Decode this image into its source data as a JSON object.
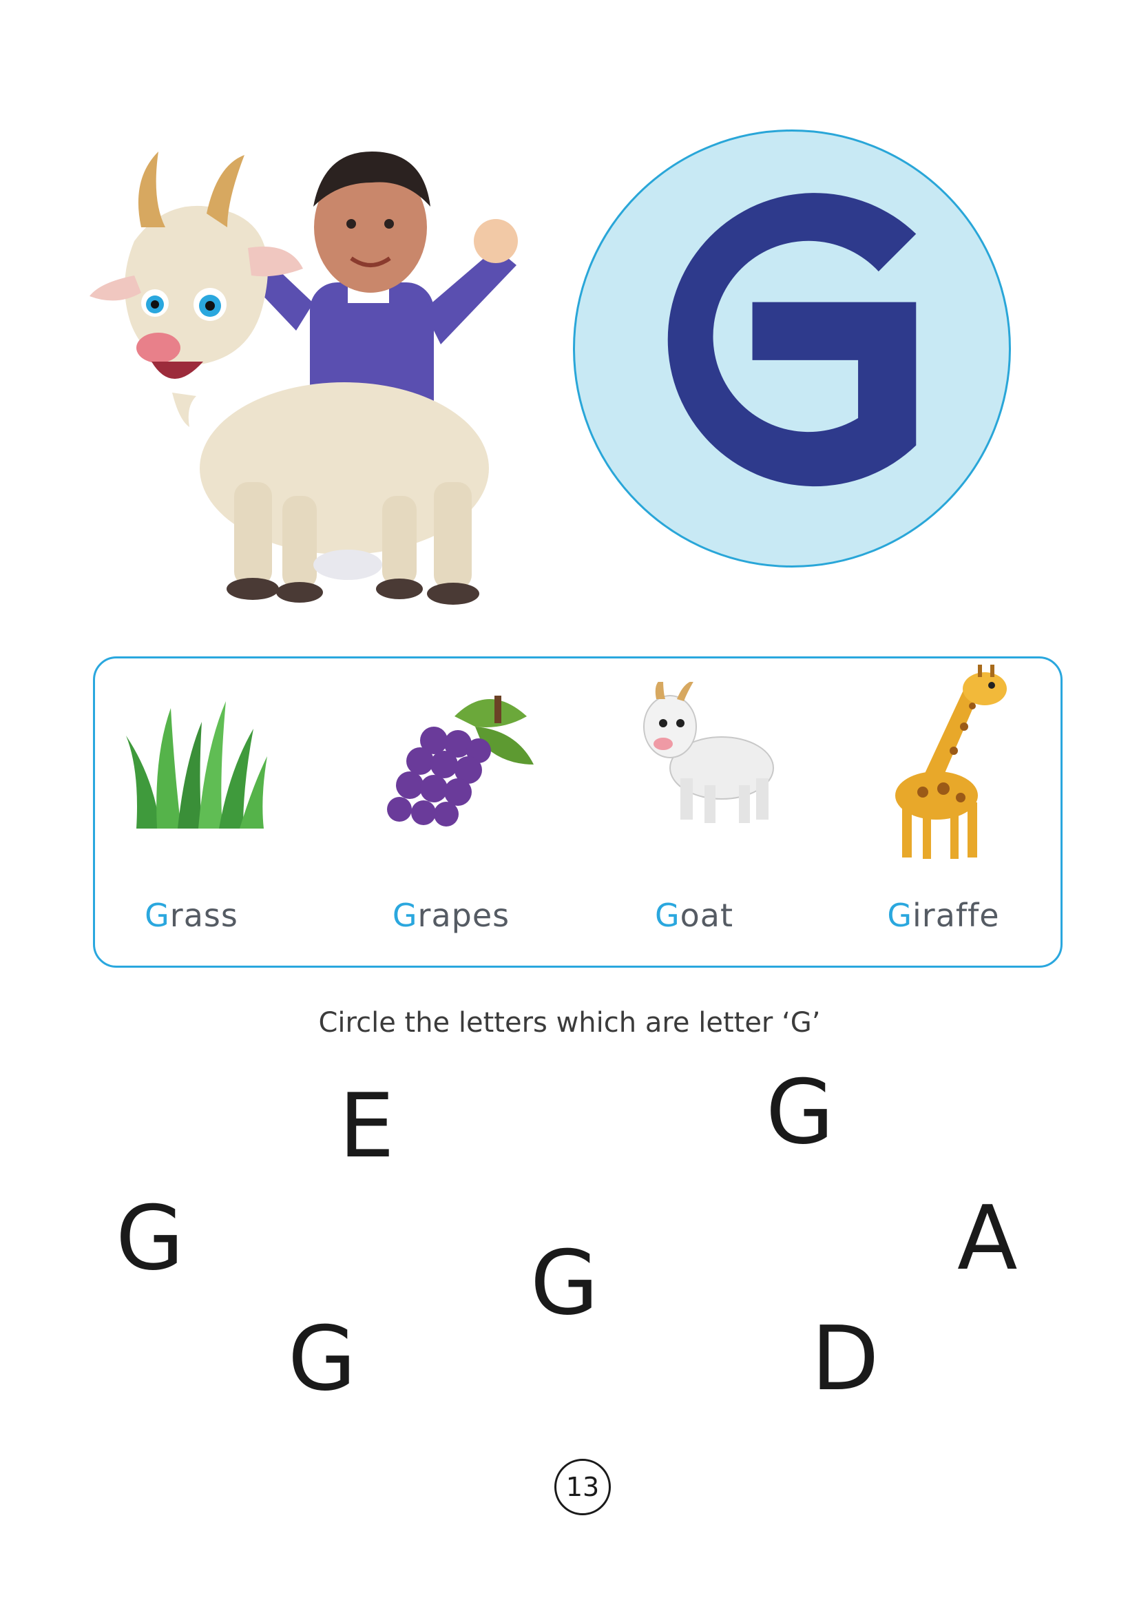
{
  "hero": {
    "letter": "G",
    "colors": {
      "circle_fill": "#c8e9f4",
      "circle_stroke": "#29a6d8",
      "letter": "#2e3a8c"
    }
  },
  "words": [
    {
      "first": "G",
      "rest": "rass",
      "icon": "grass-icon"
    },
    {
      "first": "G",
      "rest": "rapes",
      "icon": "grapes-icon"
    },
    {
      "first": "G",
      "rest": "oat",
      "icon": "goat-icon"
    },
    {
      "first": "G",
      "rest": "iraffe",
      "icon": "giraffe-icon"
    }
  ],
  "instruction": "Circle the letters which are letter ‘G’",
  "puzzle": {
    "letters": [
      "E",
      "G",
      "G",
      "G",
      "A",
      "G",
      "D"
    ]
  },
  "page_number": "13",
  "colors": {
    "accent": "#2aa7de",
    "text": "#1a1a1a"
  }
}
